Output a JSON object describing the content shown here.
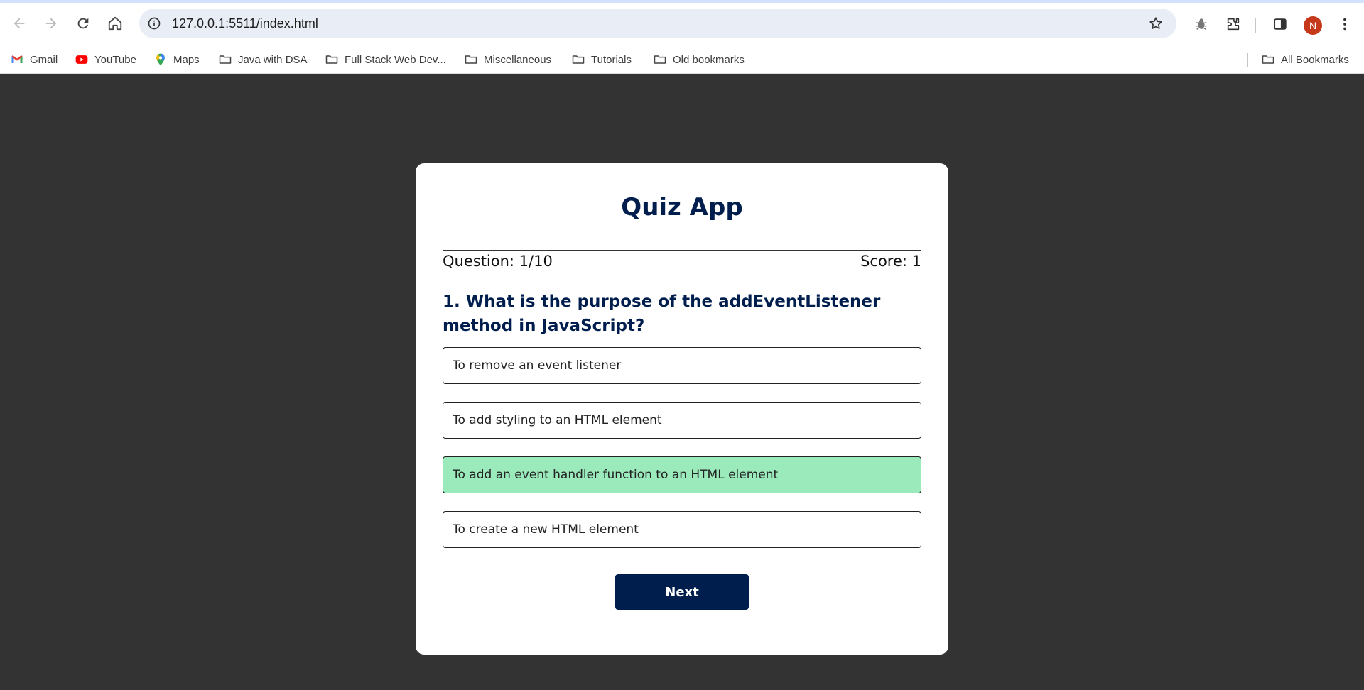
{
  "browser": {
    "url": "127.0.0.1:5511/index.html",
    "profile_initial": "N",
    "profile_color": "#c5381a",
    "bookmarks": [
      {
        "label": "Gmail",
        "icon": "gmail-icon"
      },
      {
        "label": "YouTube",
        "icon": "youtube-icon"
      },
      {
        "label": "Maps",
        "icon": "maps-icon"
      },
      {
        "label": "Java with DSA",
        "icon": "folder-icon"
      },
      {
        "label": "Full Stack Web Dev...",
        "icon": "folder-icon"
      },
      {
        "label": "Miscellaneous",
        "icon": "folder-icon"
      },
      {
        "label": "Tutorials",
        "icon": "folder-icon"
      },
      {
        "label": "Old bookmarks",
        "icon": "folder-icon"
      }
    ],
    "all_bookmarks": "All Bookmarks"
  },
  "quiz": {
    "title": "Quiz App",
    "question_counter": "Question: 1/10",
    "score": "Score: 1",
    "question": "1. What is the purpose of the addEventListener method in JavaScript?",
    "answers": [
      {
        "text": "To remove an event listener",
        "state": "default"
      },
      {
        "text": "To add styling to an HTML element",
        "state": "default"
      },
      {
        "text": "To add an event handler function to an HTML element",
        "state": "correct"
      },
      {
        "text": "To create a new HTML element",
        "state": "default"
      }
    ],
    "next_label": "Next",
    "colors": {
      "background": "#333333",
      "primary": "#001e4d",
      "correct": "#9aeabc"
    }
  }
}
